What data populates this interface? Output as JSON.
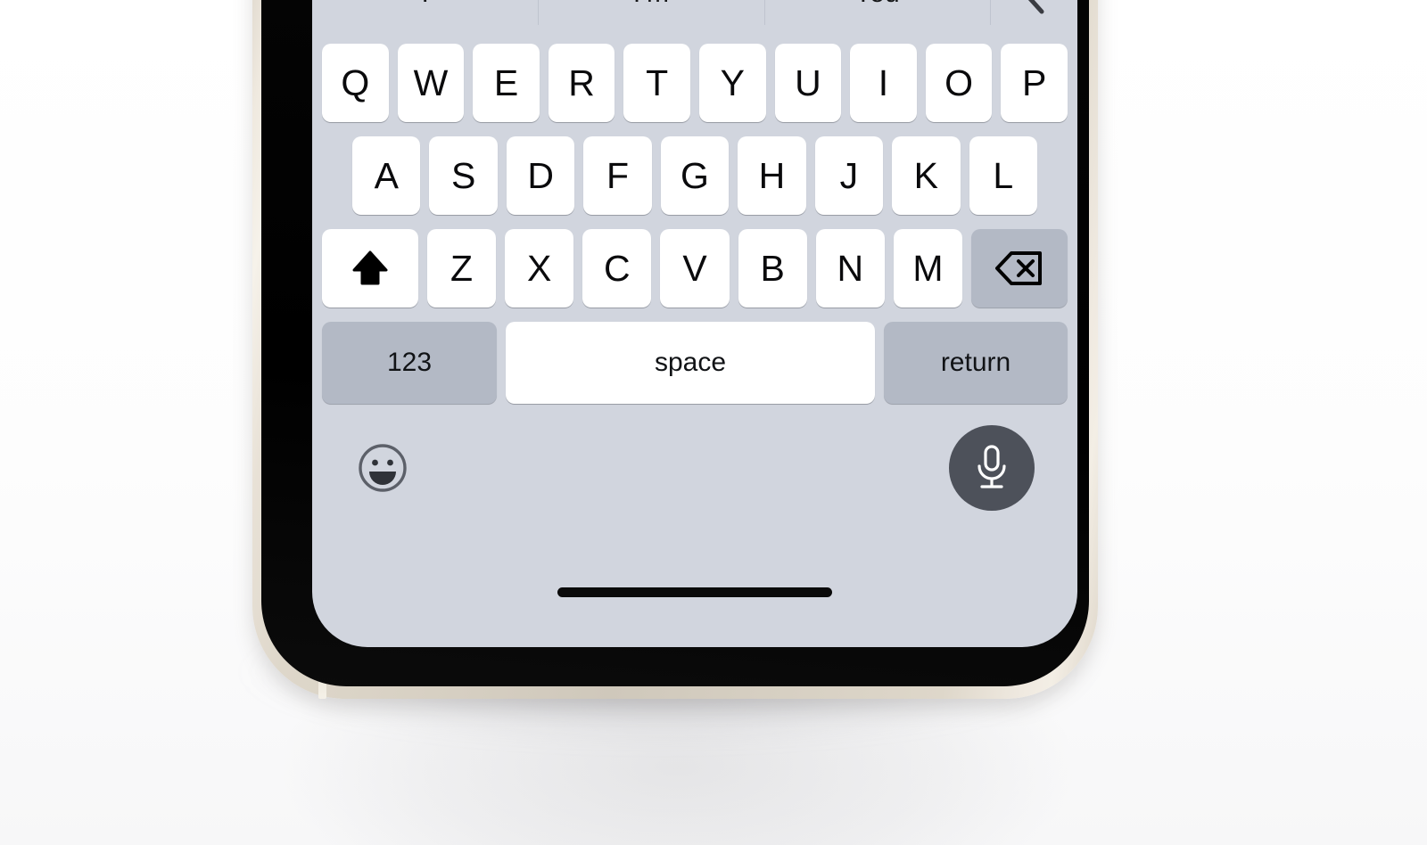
{
  "device": {
    "name": "iphone-keyboard",
    "frame_color": "#ddd6cb",
    "bezel_color": "#000000",
    "screen_background": "#d1d5de"
  },
  "predictive_bar": {
    "suggestions": [
      {
        "label": "I"
      },
      {
        "label": "I’m"
      },
      {
        "label": "You"
      }
    ],
    "expand_icon": "chevron-left-icon"
  },
  "keyboard": {
    "rows": {
      "top": [
        "Q",
        "W",
        "E",
        "R",
        "T",
        "Y",
        "U",
        "I",
        "O",
        "P"
      ],
      "home": [
        "A",
        "S",
        "D",
        "F",
        "G",
        "H",
        "J",
        "K",
        "L"
      ],
      "bottom": [
        "Z",
        "X",
        "C",
        "V",
        "B",
        "N",
        "M"
      ]
    },
    "shift": {
      "icon": "shift-arrow-up-icon",
      "state": "active"
    },
    "backspace": {
      "icon": "delete-left-icon"
    },
    "numeric_label": "123",
    "space_label": "space",
    "return_label": "return",
    "key_color": "#ffffff",
    "modifier_key_color": "#b3b9c5"
  },
  "utility_row": {
    "emoji": {
      "icon": "smiley-face-icon"
    },
    "dictation": {
      "icon": "microphone-icon",
      "button_color": "#4d515a"
    }
  },
  "home_indicator": {
    "name": "home-indicator",
    "color": "#0a0a0a"
  }
}
